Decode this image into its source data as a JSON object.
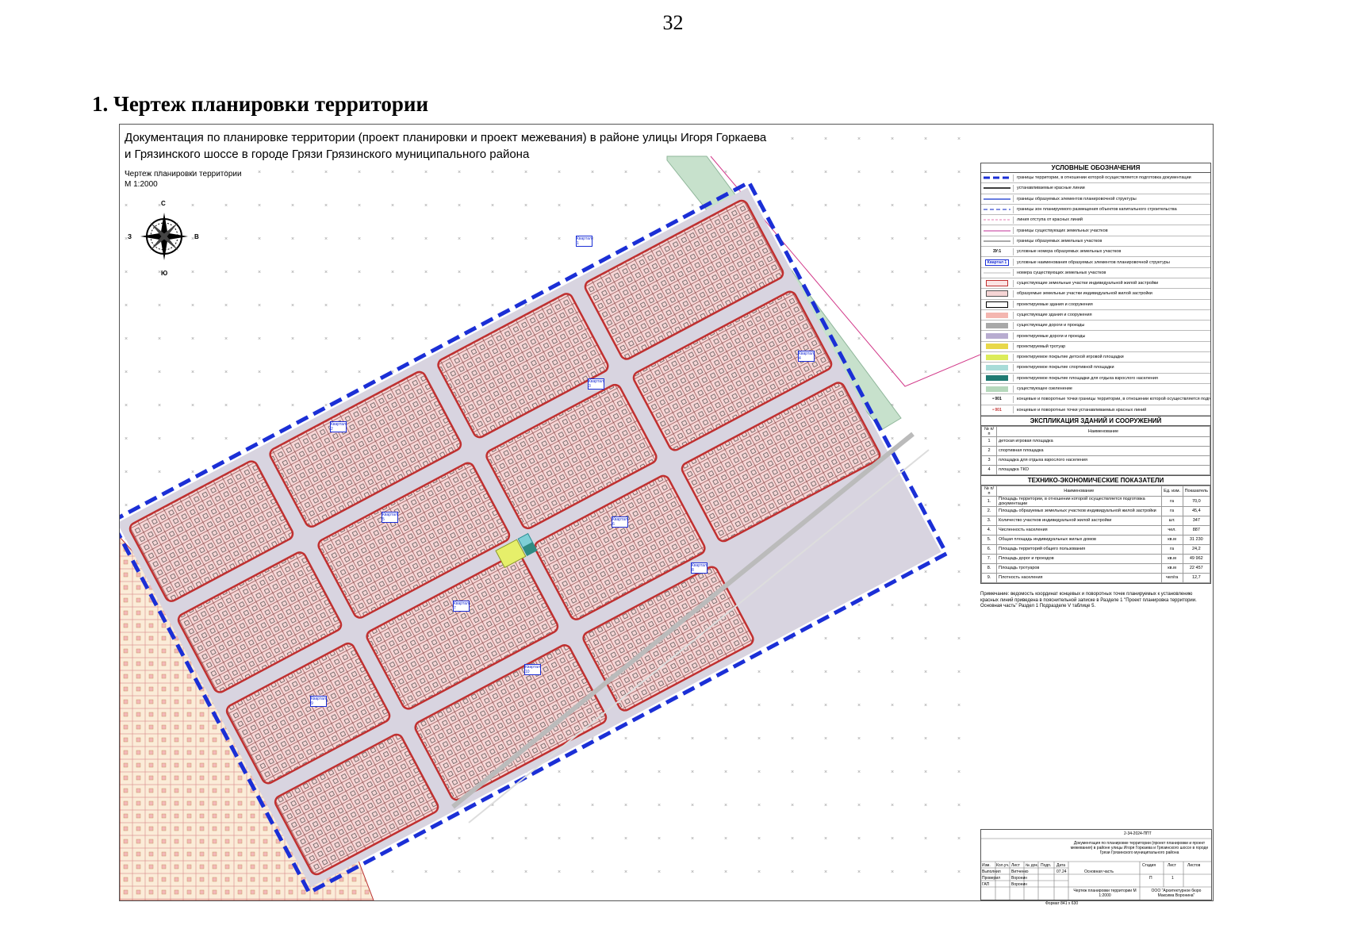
{
  "page_number": "32",
  "section_title": "1. Чертеж планировки территории",
  "sheet": {
    "title_line1": "Документация по планировке территории (проект планировки и проект межевания) в районе улицы Игоря Горкаева",
    "title_line2": "и Грязинского шоссе в городе Грязи Грязинского муниципального района",
    "plan_name": "Чертеж планировки территории",
    "scale": "М 1:2000",
    "compass": {
      "north": "С",
      "south": "Ю",
      "west": "З",
      "east": "В"
    },
    "quarter_labels": [
      "Квартал 1",
      "Квартал 2",
      "Квартал 3",
      "Квартал 4",
      "Квартал 5",
      "Квартал 6",
      "Квартал 7",
      "Квартал 8",
      "Квартал 9",
      "Квартал 10"
    ]
  },
  "legend": {
    "title": "УСЛОВНЫЕ ОБОЗНАЧЕНИЯ",
    "items": [
      {
        "symbol": "dash-blue-thick",
        "label": "границы территории, в отношении которой осуществляется подготовка документации"
      },
      {
        "symbol": "line-black",
        "label": "устанавливаемые красные линии"
      },
      {
        "symbol": "line-blue",
        "label": "границы образуемых элементов планировочной структуры"
      },
      {
        "symbol": "dash-blue-thin",
        "label": "границы зон планируемого размещения объектов капитального строительства"
      },
      {
        "symbol": "dash-pink",
        "label": "линия отступа от красных линий"
      },
      {
        "symbol": "line-magenta",
        "label": "границы существующих земельных участков"
      },
      {
        "symbol": "line-gray",
        "label": "границы образуемых земельных участков"
      },
      {
        "symbol": "text-zu",
        "text": "ЗУ:1",
        "label": "условные номера образуемых земельных участков"
      },
      {
        "symbol": "text-box",
        "text": "Квартал 1",
        "label": "условные наименования образуемых элементов планировочной структуры"
      },
      {
        "symbol": "line-light",
        "label": "номера существующих земельных участков"
      },
      {
        "symbol": "box-red",
        "label": "существующие земельные участки индивидуальной жилой застройки"
      },
      {
        "symbol": "box-pink",
        "label": "образуемые земельные участки индивидуальной жилой застройки"
      },
      {
        "symbol": "box-black",
        "label": "проектируемые здания и сооружения"
      },
      {
        "symbol": "fill-salmon",
        "label": "существующие здания и сооружения"
      },
      {
        "symbol": "fill-gray",
        "label": "существующие дороги и проезды"
      },
      {
        "symbol": "fill-lavender",
        "label": "проектируемые дороги и проезды"
      },
      {
        "symbol": "fill-yellow",
        "label": "проектируемый тротуар"
      },
      {
        "symbol": "fill-lime",
        "label": "проектируемое покрытие детской игровой площадки"
      },
      {
        "symbol": "fill-cyan",
        "label": "проектируемое покрытие спортивной площадки"
      },
      {
        "symbol": "fill-teal",
        "label": "проектируемое покрытие площадки для отдыха взрослого населения"
      },
      {
        "symbol": "fill-green",
        "label": "существующее озеленение"
      },
      {
        "symbol": "point-black",
        "text": "001",
        "label": "концевые и поворотные точки границы территории, в отношении которой осуществляется подготовка документации"
      },
      {
        "symbol": "point-red",
        "text": "001",
        "label": "концевые и поворотные точки устанавливаемых красных линий"
      }
    ]
  },
  "explication": {
    "title": "ЭКСПЛИКАЦИЯ ЗДАНИЙ И СООРУЖЕНИЙ",
    "headers": [
      "№ п/п",
      "Наименование"
    ],
    "rows": [
      [
        "1",
        "детская игровая площадка"
      ],
      [
        "2",
        "спортивная площадка"
      ],
      [
        "3",
        "площадка для отдыха взрослого населения"
      ],
      [
        "4",
        "площадка ТКО"
      ]
    ]
  },
  "indicators": {
    "title": "ТЕХНИКО-ЭКОНОМИЧЕСКИЕ ПОКАЗАТЕЛИ",
    "headers": [
      "№ п/п",
      "Наименование",
      "Ед. изм.",
      "Показатель"
    ],
    "rows": [
      [
        "1.",
        "Площадь территории, в отношении которой осуществляется подготовка документации",
        "га",
        "70,0"
      ],
      [
        "2.",
        "Площадь образуемых земельных участков индивидуальной жилой застройки",
        "га",
        "45,4"
      ],
      [
        "3.",
        "Количество участков индивидуальной жилой застройки",
        "шт.",
        "347"
      ],
      [
        "4.",
        "Численность населения",
        "чел.",
        "887"
      ],
      [
        "5.",
        "Общая площадь индивидуальных жилых домов",
        "кв.м",
        "31 230"
      ],
      [
        "6.",
        "Площадь территорий общего пользования",
        "га",
        "24,2"
      ],
      [
        "7.",
        "Площадь дорог и проездов",
        "кв.м",
        "49 962"
      ],
      [
        "8.",
        "Площадь тротуаров",
        "кв.м",
        "22 457"
      ],
      [
        "9.",
        "Плотность населения",
        "чел/га",
        "12,7"
      ]
    ]
  },
  "note": "Примечание: ведомость координат концевых и поворотных точек планируемых к установлению красных линий приведена в пояснительной записке в Разделе 1 \"Проект планировка территории. Основная часть\" Раздел 1 Подразделе V таблице 5.",
  "stamp": {
    "code": "2-34-2024-ППТ",
    "doc_name": "Документация по планировке территории (проект планировки и проект межевания) в районе улицы Игоря Горкаева и Грязинского шоссе в городе Грязи Грязинского муниципального района",
    "header_cells": [
      "Изм.",
      "Кол.уч.",
      "Лист",
      "№ док.",
      "Подп.",
      "Дата"
    ],
    "roles": [
      "Выполнил",
      "Проверил",
      "ГАП"
    ],
    "names": [
      "Витченко",
      "Воронин",
      "Воронин"
    ],
    "date": "07.24",
    "part": "Основная часть",
    "stage_headers": [
      "Стадия",
      "Лист",
      "Листов"
    ],
    "stage_values": [
      "П",
      "1",
      ""
    ],
    "sheet_name": "Чертеж планировки территории М 1:2000",
    "org": "ООО \"Архитектурное бюро Максима Воронина\"",
    "format": "Формат 841 х 630"
  }
}
